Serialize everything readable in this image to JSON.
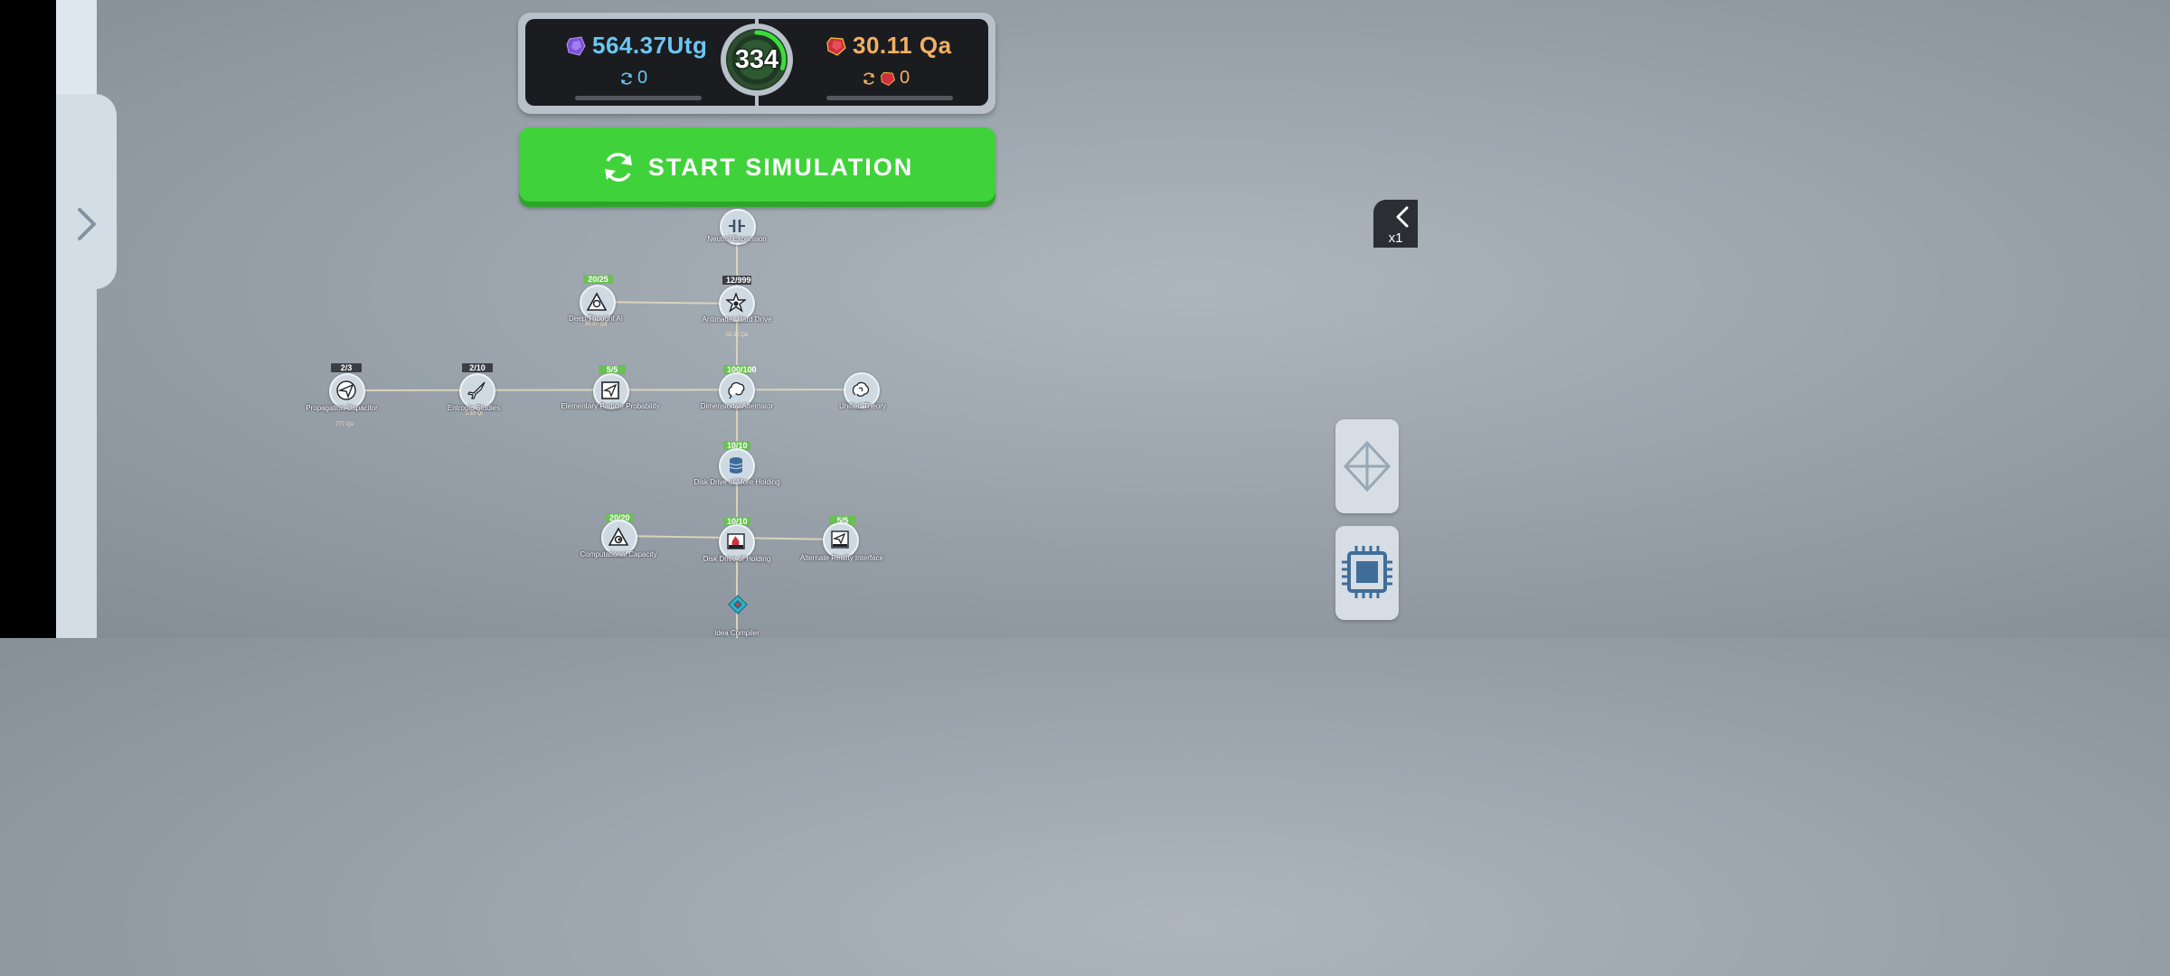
{
  "resources": {
    "primary_value": "564.37Utg",
    "primary_rate": "0",
    "secondary_value": "30.11 Qa",
    "secondary_rate": "0",
    "level": "334",
    "level_progress": 0.3
  },
  "start_button": {
    "label": "START SIMULATION"
  },
  "speed": {
    "label": "x1"
  },
  "colors": {
    "primary": "#6cc6f2",
    "secondary": "#f2b063",
    "start": "#3fd23a",
    "panel": "#1a1c20"
  },
  "nodes": {
    "neutral_expansion": {
      "name": "Neutral Expansion",
      "icon": "capacitor-icon"
    },
    "deep_thought": {
      "name": "Deep Thought AI",
      "count": "20/25",
      "cost": "10.37 Qa",
      "icon": "bulb-triangle-icon"
    },
    "antimatter": {
      "name": "Antimatter Hard Drive",
      "count": "12/999",
      "cost": "55.32 Qa",
      "icon": "star-icon"
    },
    "propagation": {
      "name": "Propagation Capacitor",
      "count": "2/3",
      "cost": "777 Qa",
      "icon": "paper-plane-icon"
    },
    "entropic": {
      "name": "Entropic Studies",
      "count": "2/10",
      "cost": "1.33 Qi",
      "icon": "jet-icon"
    },
    "elementary": {
      "name": "Elementary Particle Probability",
      "count": "5/5",
      "icon": "plane-square-icon"
    },
    "dimensional": {
      "name": "Dimensional Alternator",
      "count": "100/100",
      "icon": "brain-icon"
    },
    "unified": {
      "name": "Unified Theory",
      "icon": "brain-swirl-icon"
    },
    "disk_more": {
      "name": "Disk Drive of More Holding",
      "count": "10/10",
      "icon": "database-icon"
    },
    "computational": {
      "name": "Computational Capacity",
      "count": "20/20",
      "icon": "eye-triangle-icon"
    },
    "disk_holding": {
      "name": "Disk Drive of Holding",
      "count": "10/10",
      "icon": "fire-disk-icon"
    },
    "alternate": {
      "name": "Alternate Reality Interface",
      "count": "5/5",
      "icon": "plane-screen-icon"
    },
    "idea_compiler": {
      "name": "Idea Compiler",
      "icon": "diamond-chip-icon"
    }
  }
}
